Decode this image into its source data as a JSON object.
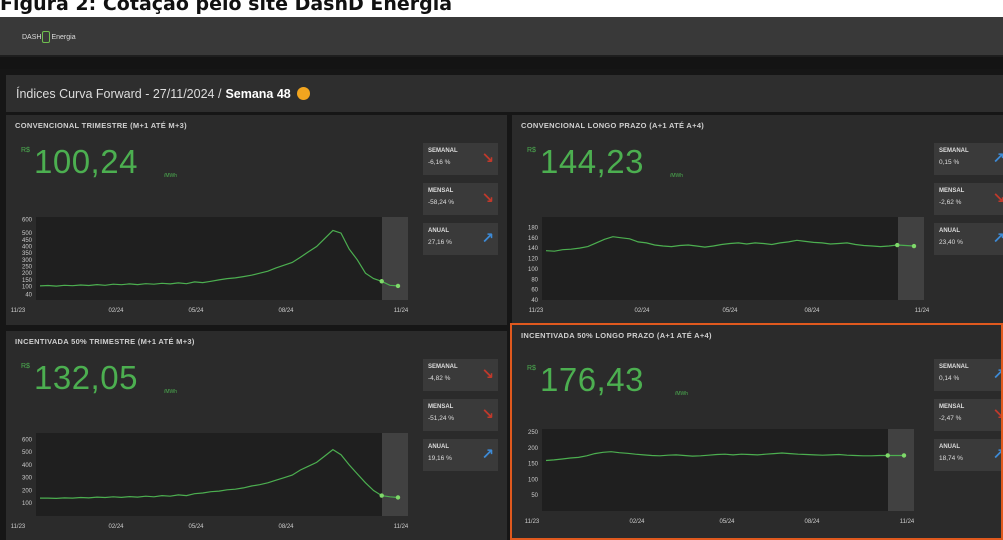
{
  "caption": "Figura 2: Cotação pelo site DashD Energia",
  "app": {
    "logo_left": "DASH",
    "logo_right": "Energia"
  },
  "header": {
    "title": "Índices Curva Forward - 27/11/2024 /",
    "week": "Semana 48"
  },
  "colors": {
    "green": "#4caf50",
    "down": "#c0392b",
    "up": "#3d8ad6",
    "selected_border": "#e0591e",
    "week_dot": "#f2a51f"
  },
  "panels": [
    {
      "title": "CONVENCIONAL TRIMESTRE (M+1 ATÉ M+3)",
      "currency": "R$",
      "value": "100,24",
      "unit": "/MWh",
      "stats": [
        {
          "label": "SEMANAL",
          "value": "-6,16 %",
          "dir": "down"
        },
        {
          "label": "MENSAL",
          "value": "-58,24 %",
          "dir": "down"
        },
        {
          "label": "ANUAL",
          "value": "27,16 %",
          "dir": "up"
        }
      ]
    },
    {
      "title": "CONVENCIONAL LONGO PRAZO (A+1 ATÉ A+4)",
      "currency": "R$",
      "value": "144,23",
      "unit": "/MWh",
      "stats": [
        {
          "label": "SEMANAL",
          "value": "0,15 %",
          "dir": "up"
        },
        {
          "label": "MENSAL",
          "value": "-2,62 %",
          "dir": "down"
        },
        {
          "label": "ANUAL",
          "value": "23,40 %",
          "dir": "up"
        }
      ]
    },
    {
      "title": "INCENTIVADA 50% TRIMESTRE (M+1 ATÉ M+3)",
      "currency": "R$",
      "value": "132,05",
      "unit": "/MWh",
      "stats": [
        {
          "label": "SEMANAL",
          "value": "-4,82 %",
          "dir": "down"
        },
        {
          "label": "MENSAL",
          "value": "-51,24 %",
          "dir": "down"
        },
        {
          "label": "ANUAL",
          "value": "19,16 %",
          "dir": "up"
        }
      ]
    },
    {
      "title": "INCENTIVADA 50% LONGO PRAZO (A+1 ATÉ A+4)",
      "currency": "R$",
      "value": "176,43",
      "unit": "/MWh",
      "stats": [
        {
          "label": "SEMANAL",
          "value": "0,14 %",
          "dir": "up"
        },
        {
          "label": "MENSAL",
          "value": "-2,47 %",
          "dir": "down"
        },
        {
          "label": "ANUAL",
          "value": "18,74 %",
          "dir": "up"
        }
      ]
    }
  ],
  "chart_data": [
    {
      "type": "line",
      "x_ticks": [
        "11/23",
        "02/24",
        "05/24",
        "08/24",
        "11/24"
      ],
      "y_ticks": [
        40,
        100,
        150,
        200,
        250,
        300,
        350,
        400,
        450,
        500,
        600
      ],
      "ylim": [
        0,
        620
      ],
      "series": [
        {
          "values": [
            105,
            108,
            104,
            110,
            107,
            112,
            108,
            115,
            110,
            118,
            114,
            120,
            115,
            122,
            118,
            125,
            120,
            128,
            122,
            135,
            130,
            140,
            150,
            160,
            165,
            175,
            185,
            200,
            215,
            240,
            260,
            280,
            320,
            360,
            400,
            460,
            520,
            500,
            380,
            300,
            200,
            160,
            140,
            110,
            105
          ]
        }
      ]
    },
    {
      "type": "line",
      "x_ticks": [
        "11/23",
        "02/24",
        "05/24",
        "08/24",
        "11/24"
      ],
      "y_ticks": [
        40,
        60,
        80,
        100,
        120,
        140,
        160,
        180
      ],
      "ylim": [
        40,
        200
      ],
      "series": [
        {
          "values": [
            135,
            134,
            137,
            138,
            140,
            143,
            150,
            157,
            162,
            160,
            158,
            152,
            150,
            146,
            144,
            143,
            145,
            146,
            144,
            142,
            144,
            147,
            149,
            150,
            148,
            150,
            149,
            147,
            150,
            152,
            155,
            153,
            151,
            150,
            148,
            149,
            150,
            147,
            145,
            144,
            143,
            144,
            146,
            145,
            144
          ]
        }
      ]
    },
    {
      "type": "line",
      "x_ticks": [
        "11/23",
        "02/24",
        "05/24",
        "08/24",
        "11/24"
      ],
      "y_ticks": [
        100,
        200,
        300,
        400,
        500,
        600
      ],
      "ylim": [
        0,
        650
      ],
      "series": [
        {
          "values": [
            140,
            140,
            138,
            142,
            140,
            145,
            142,
            148,
            145,
            150,
            146,
            152,
            148,
            155,
            150,
            160,
            155,
            165,
            160,
            175,
            180,
            190,
            195,
            205,
            210,
            220,
            235,
            245,
            260,
            280,
            300,
            320,
            360,
            390,
            420,
            470,
            520,
            480,
            400,
            330,
            260,
            200,
            160,
            150,
            145
          ]
        }
      ]
    },
    {
      "type": "line",
      "x_ticks": [
        "11/23",
        "02/24",
        "05/24",
        "08/24",
        "11/24"
      ],
      "y_ticks": [
        50,
        100,
        150,
        200,
        250
      ],
      "ylim": [
        0,
        260
      ],
      "series": [
        {
          "values": [
            160,
            162,
            165,
            168,
            170,
            175,
            182,
            186,
            188,
            185,
            183,
            180,
            178,
            176,
            175,
            177,
            178,
            176,
            174,
            175,
            177,
            179,
            180,
            178,
            180,
            179,
            178,
            180,
            182,
            184,
            182,
            180,
            179,
            178,
            177,
            178,
            179,
            177,
            176,
            175,
            175,
            176,
            176,
            176,
            176
          ]
        }
      ]
    }
  ]
}
